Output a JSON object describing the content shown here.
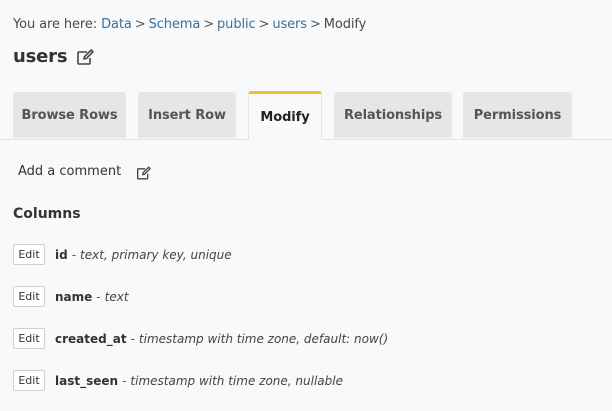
{
  "breadcrumb": {
    "prefix": "You are here:",
    "items": [
      "Data",
      "Schema",
      "public",
      "users"
    ],
    "current": "Modify",
    "separator": ">"
  },
  "page": {
    "title": "users"
  },
  "tabs": [
    {
      "label": "Browse Rows",
      "active": false
    },
    {
      "label": "Insert Row",
      "active": false
    },
    {
      "label": "Modify",
      "active": true
    },
    {
      "label": "Relationships",
      "active": false
    },
    {
      "label": "Permissions",
      "active": false
    }
  ],
  "comment": {
    "label": "Add a comment"
  },
  "columns": {
    "heading": "Columns",
    "edit_label": "Edit",
    "dash": "-",
    "rows": [
      {
        "name": "id",
        "description": "text, primary key, unique"
      },
      {
        "name": "name",
        "description": "text"
      },
      {
        "name": "created_at",
        "description": "timestamp with time zone, default: now()"
      },
      {
        "name": "last_seen",
        "description": "timestamp with time zone, nullable"
      }
    ]
  },
  "colors": {
    "link": "#3a6f9c",
    "active_tab_accent": "#f5bd2e",
    "tab_background": "#e6e6e6",
    "page_background": "#f8f9fa"
  },
  "icons": {
    "title_edit": "edit-icon",
    "comment_edit": "edit-icon"
  }
}
